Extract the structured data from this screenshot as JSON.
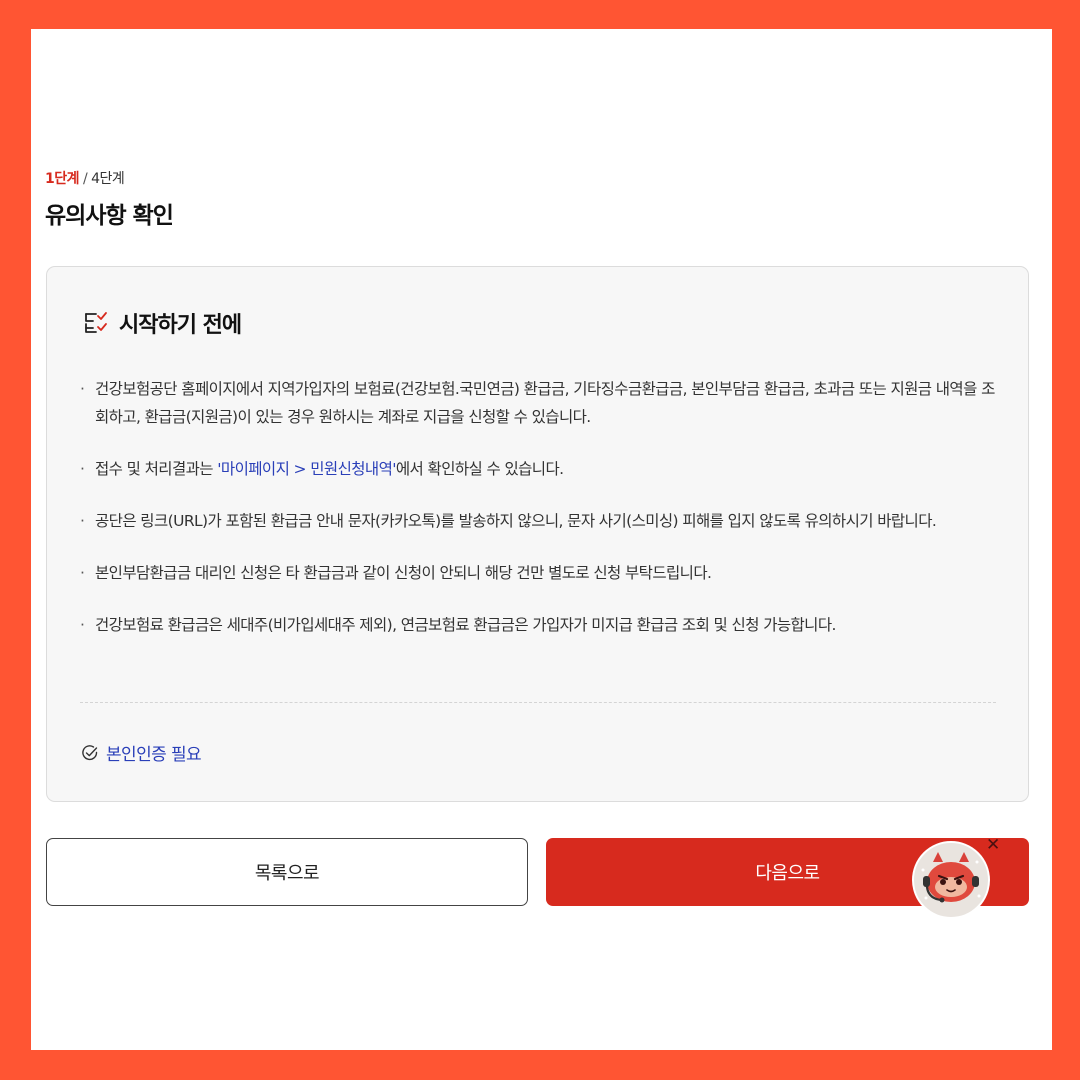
{
  "step": {
    "current": "1단계",
    "separator": " / ",
    "total": "4단계"
  },
  "page_title": "유의사항 확인",
  "card": {
    "icon": "checklist-icon",
    "title": "시작하기 전에",
    "notes": [
      {
        "text": "건강보험공단 홈페이지에서 지역가입자의 보험료(건강보험.국민연금) 환급금, 기타징수금환급금, 본인부담금 환급금, 초과금 또는 지원금 내역을 조회하고, 환급금(지원금)이 있는 경우 원하시는 계좌로 지급을 신청할 수 있습니다."
      },
      {
        "before": "접수 및 처리결과는 ",
        "link": "'마이페이지 > 민원신청내역'",
        "after": "에서 확인하실 수 있습니다."
      },
      {
        "text": "공단은 링크(URL)가 포함된 환급금 안내 문자(카카오톡)를 발송하지 않으니, 문자 사기(스미싱) 피해를 입지 않도록 유의하시기 바랍니다."
      },
      {
        "text": "본인부담환급금 대리인 신청은 타 환급금과 같이 신청이 안되니 해당 건만 별도로 신청 부탁드립니다."
      },
      {
        "text": "건강보험료 환급금은 세대주(비가입세대주 제외), 연금보험료 환급금은 가입자가 미지급 환급금 조회 및 신청 가능합니다."
      }
    ],
    "auth_icon": "check-circle-icon",
    "auth_label": "본인인증 필요"
  },
  "buttons": {
    "list": "목록으로",
    "next": "다음으로"
  },
  "mascot": {
    "icon": "chatbot-mascot-icon",
    "close": "✕"
  },
  "colors": {
    "frame": "#ff5533",
    "accent": "#d72a1e",
    "link": "#2a3fb8"
  }
}
